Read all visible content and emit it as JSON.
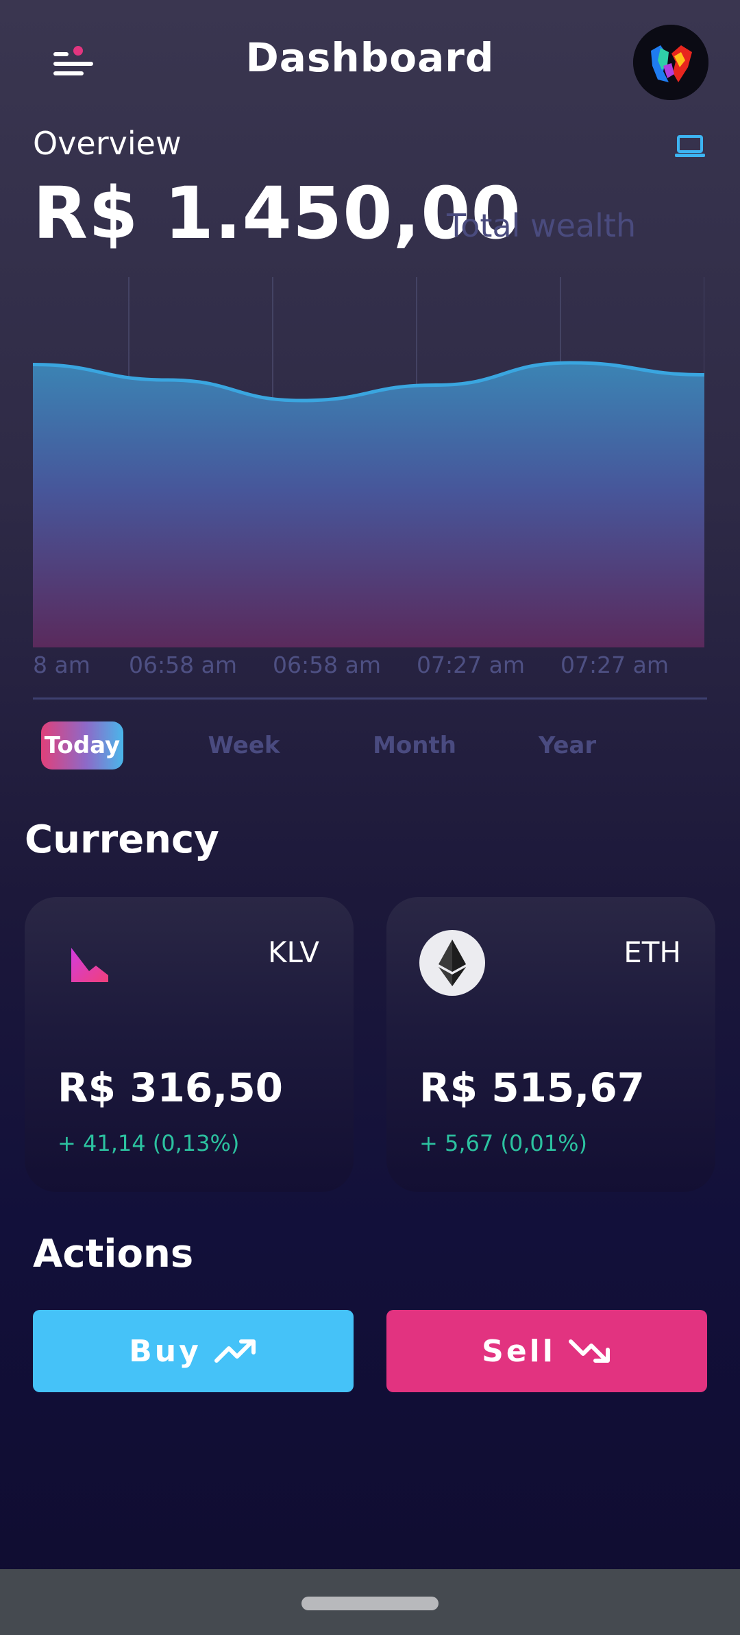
{
  "header": {
    "title": "Dashboard"
  },
  "overview": {
    "label": "Overview",
    "total_value": "R$ 1.450,00",
    "total_caption": "Total wealth"
  },
  "chart_data": {
    "type": "area",
    "x": [
      "8 am",
      "06:58 am",
      "06:58 am",
      "07:27 am",
      "07:27 am"
    ],
    "y": [
      1465,
      1456,
      1444,
      1453,
      1466,
      1459
    ],
    "colors": {
      "line": "#3aa6e0",
      "fill_top": "#3b84b4",
      "fill_bottom": "#5a2a5c"
    }
  },
  "periods": {
    "items": [
      "Today",
      "Week",
      "Month",
      "Year"
    ],
    "selected": "Today"
  },
  "currency": {
    "title": "Currency",
    "cards": [
      {
        "symbol": "KLV",
        "price": "R$ 316,50",
        "change": "+ 41,14 (0,13%)",
        "icon": "klever-logo-icon"
      },
      {
        "symbol": "ETH",
        "price": "R$ 515,67",
        "change": "+ 5,67 (0,01%)",
        "icon": "ethereum-logo-icon"
      }
    ]
  },
  "actions": {
    "title": "Actions",
    "buy_label": "Buy",
    "sell_label": "Sell",
    "buy_icon": "trending-up-icon",
    "sell_icon": "trending-down-icon"
  },
  "colors": {
    "accent_blue": "#45c2f8",
    "accent_pink": "#e23380",
    "positive": "#2cc2a0",
    "muted": "#4a4b80"
  }
}
